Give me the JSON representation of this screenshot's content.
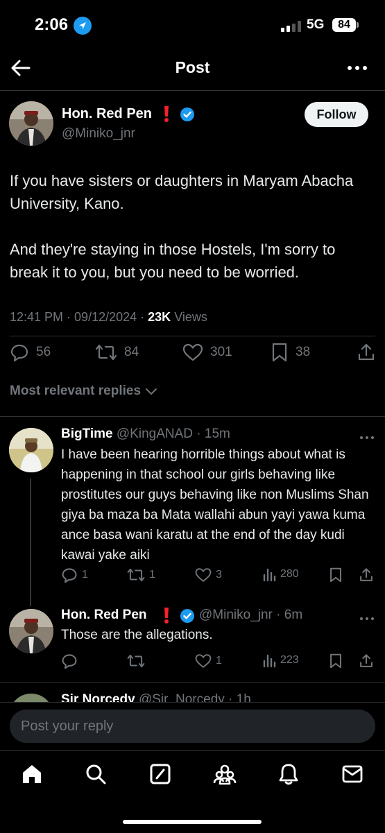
{
  "status_bar": {
    "time": "2:06",
    "network": "5G",
    "battery": "84"
  },
  "header": {
    "title": "Post"
  },
  "post": {
    "author_name": "Hon. Red Pen",
    "handle": "@Miniko_jnr",
    "follow_label": "Follow",
    "text": "If you have sisters or daughters in Maryam Abacha University, Kano.\n\nAnd they're staying in those Hostels, I'm sorry to break it to you, but you need to be worried.",
    "time": "12:41 PM",
    "date": "09/12/2024",
    "views_count": "23K",
    "views_label": "Views",
    "replies": "56",
    "reposts": "84",
    "likes": "301",
    "bookmarks": "38"
  },
  "replies_filter": {
    "label": "Most relevant replies"
  },
  "replies": [
    {
      "name": "BigTime",
      "handle": "@KingANAD",
      "time": "15m",
      "text": "I have been hearing horrible things about what is happening in that school our girls behaving like prostitutes our guys behaving like non Muslims Shan giya ba maza ba Mata wallahi abun yayi yawa kuma ance basa wani karatu at the end of the day kudi kawai yake aiki",
      "replies": "1",
      "reposts": "1",
      "likes": "3",
      "views": "280"
    },
    {
      "name": "Hon. Red Pen",
      "handle": "@Miniko_jnr",
      "time": "6m",
      "text": "Those are the allegations.",
      "replies": "",
      "reposts": "",
      "likes": "1",
      "views": "223"
    },
    {
      "name": "Sir Norcedy",
      "handle": "@Sir_Norcedy",
      "time": "1h"
    }
  ],
  "composer": {
    "placeholder": "Post your reply"
  },
  "colors": {
    "accent": "#1d9bf0",
    "background": "#000000",
    "muted": "#71767b",
    "alert": "#f4212e"
  },
  "icons": [
    "location-arrow-icon",
    "signal-icon",
    "back-arrow-icon",
    "more-icon",
    "verified-icon",
    "exclamation-icon",
    "reply-icon",
    "repost-icon",
    "like-icon",
    "bookmark-icon",
    "share-icon",
    "views-icon",
    "chevron-down-icon",
    "home-icon",
    "search-icon",
    "grok-icon",
    "communities-icon",
    "notifications-icon",
    "messages-icon"
  ]
}
